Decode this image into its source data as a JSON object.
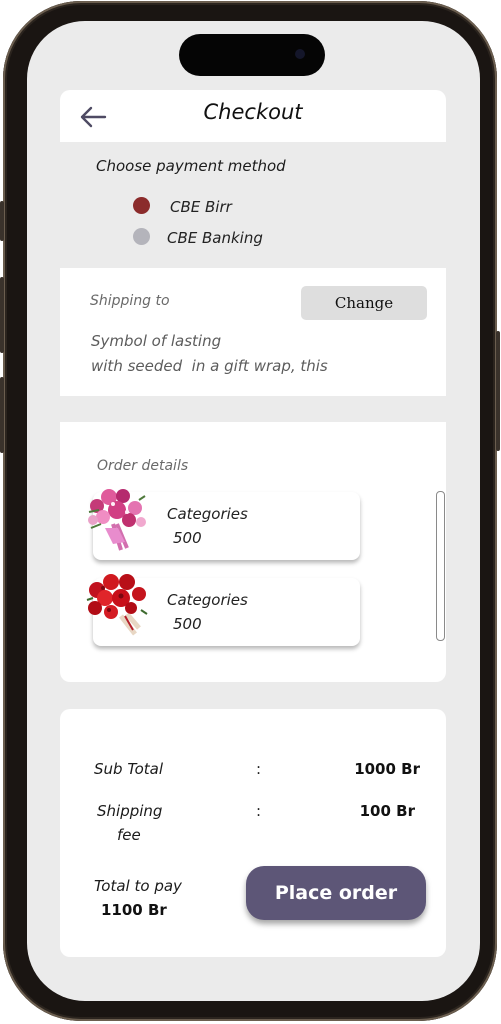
{
  "header": {
    "title": "Checkout"
  },
  "payment": {
    "title": "Choose payment method",
    "options": [
      {
        "label": "CBE Birr",
        "color": "#8b2b2b",
        "selected": true
      },
      {
        "label": "CBE Banking",
        "color": "#b4b4bb",
        "selected": false
      }
    ]
  },
  "shipping": {
    "label": "Shipping to",
    "change_label": "Change",
    "address_lines": [
      "Symbol of lasting",
      "with seeded  in a gift wrap, this"
    ]
  },
  "order": {
    "label": "Order details",
    "items": [
      {
        "name": "Categories",
        "price": "500",
        "thumb": "pink-bouquet"
      },
      {
        "name": "Categories",
        "price": "500",
        "thumb": "red-rose-bouquet"
      }
    ]
  },
  "summary": {
    "subtotal_label": "Sub Total",
    "subtotal_value": "1000 Br",
    "shipping_label_1": "Shipping",
    "shipping_label_2": "fee",
    "shipping_value": "100 Br",
    "colon": ":",
    "total_label": "Total to pay",
    "total_value": "1100 Br",
    "place_order_label": "Place order"
  },
  "colors": {
    "accent": "#5d5677",
    "background": "#ebebeb",
    "card": "#ffffff"
  }
}
